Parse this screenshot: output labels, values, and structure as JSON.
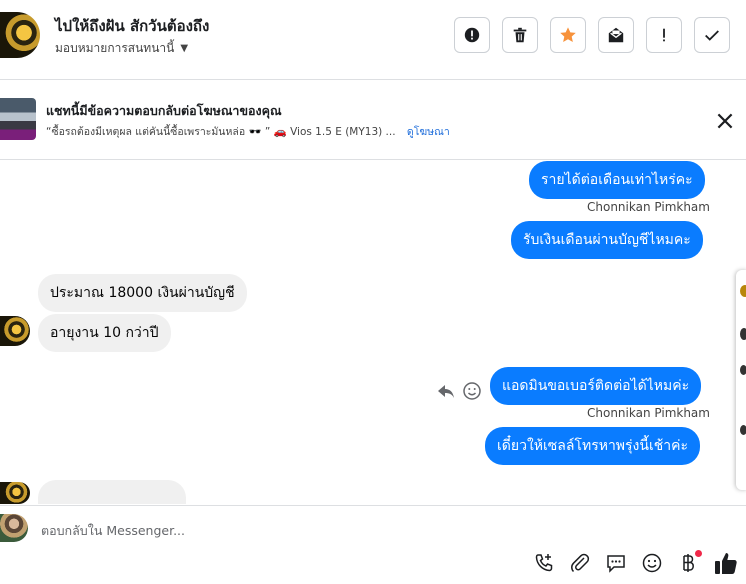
{
  "header": {
    "title": "ไปให้ถึงฝัน สักวันต้องถึง",
    "subtitle": "มอบหมายการสนทนานี้",
    "actions": [
      "spam-report",
      "delete",
      "star",
      "mark-unread",
      "important",
      "done"
    ]
  },
  "ad_banner": {
    "title": "แชทนี้มีข้อความตอบกลับต่อโฆษณาของคุณ",
    "description": "“ซื้อรถต้องมีเหตุผล แต่คันนี้ซื้อเพราะมันหล่อ 🕶️ ” 🚗 Vios 1.5 E (MY13) ...",
    "link": "ดูโฆษณา"
  },
  "messages": [
    {
      "direction": "out",
      "text": "รายได้ต่อเดือนเท่าไหร่คะ"
    },
    {
      "direction": "out",
      "sender": "Chonnikan Pimkham",
      "text": "รับเงินเดือนผ่านบัญชีไหมคะ"
    },
    {
      "direction": "in",
      "text": "ประมาณ 18000 เงินผ่านบัญชี"
    },
    {
      "direction": "in",
      "text": "อายุงาน 10 กว่าปี"
    },
    {
      "direction": "out",
      "text": "แอดมินขอเบอร์ติดต่อได้ไหมค่ะ"
    },
    {
      "direction": "out",
      "sender": "Chonnikan Pimkham",
      "text": "เดี๋ยวให้เซลล์โทรหาพรุ่งนี้เช้าค่ะ"
    }
  ],
  "composer": {
    "placeholder": "ตอบกลับใน Messenger..."
  },
  "colors": {
    "outgoing_bubble": "#0a7cff",
    "incoming_bubble": "#f0f0f0",
    "link": "#216fdb",
    "star": "#f7923b"
  }
}
